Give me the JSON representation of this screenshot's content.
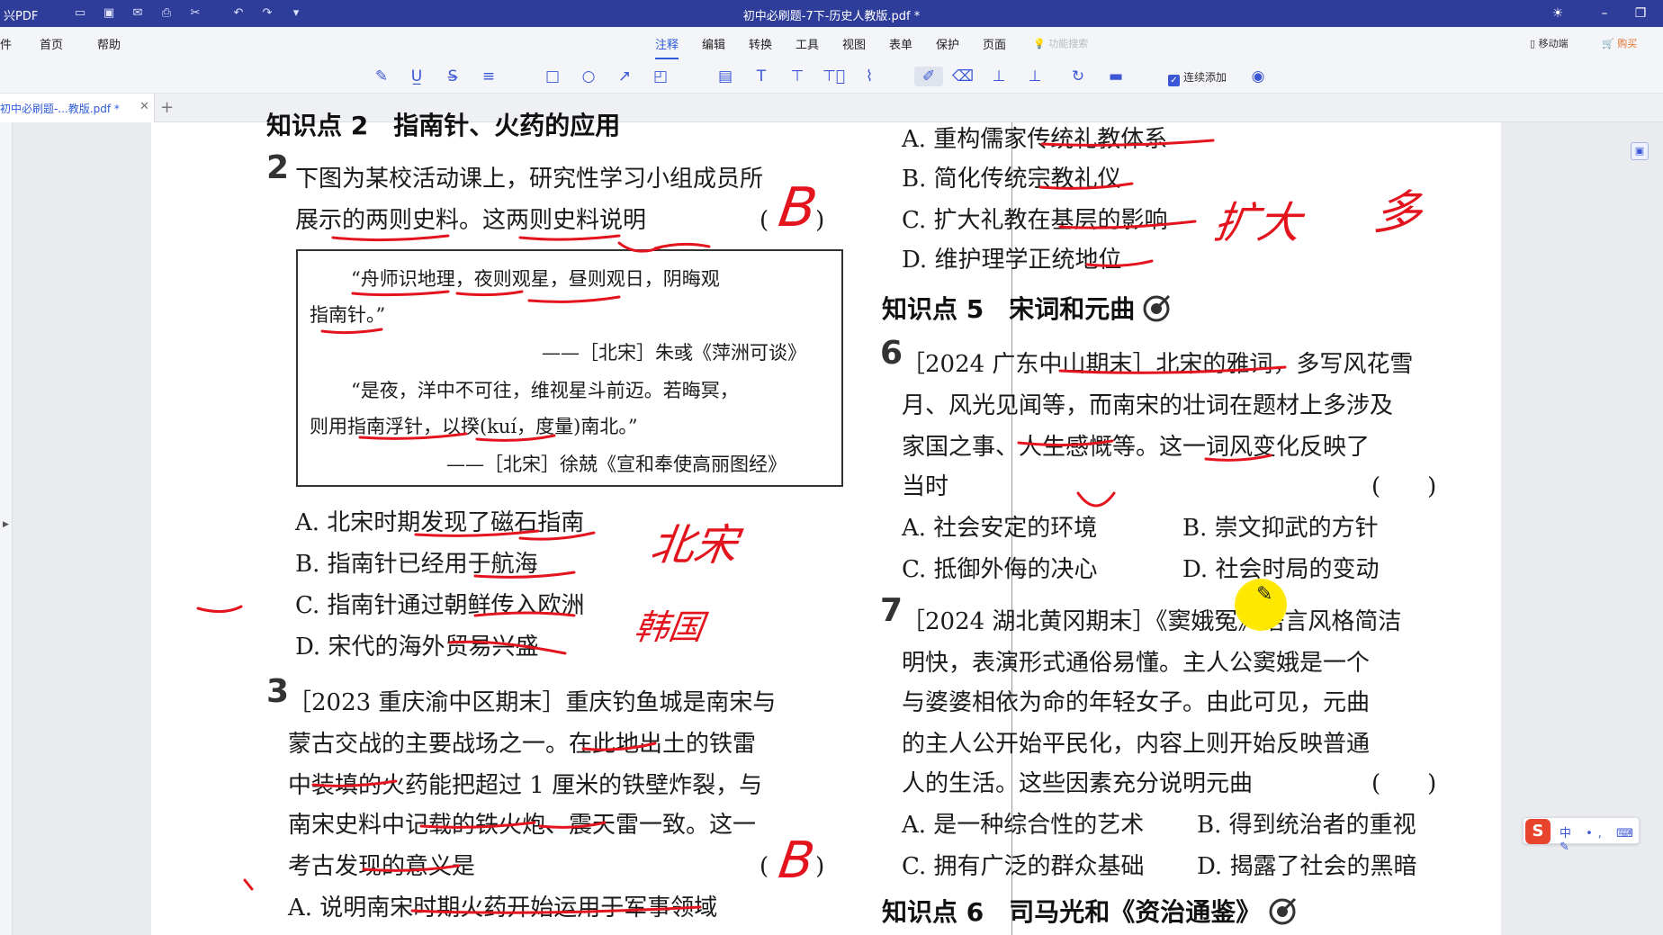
{
  "titlebar": {
    "app_name": "兴PDF",
    "doc_title": "初中必刷题-7下-历史人教版.pdf *"
  },
  "menubar": {
    "left_items": [
      "件",
      "首页",
      "帮助"
    ],
    "tabs": [
      "注释",
      "编辑",
      "转换",
      "工具",
      "视图",
      "表单",
      "保护",
      "页面"
    ],
    "active_tab": "注释",
    "feature_search": "功能搜索",
    "mobile": "移动端",
    "buy": "购买"
  },
  "toolbar": {
    "continuous_add": "连续添加"
  },
  "doc_tab": {
    "label": "初中必刷题-...教版.pdf *"
  },
  "content": {
    "left_top_heading": "知识点 2　指南针、火药的应用",
    "q2": {
      "num": "2",
      "lines": [
        "下图为某校活动课上，研究性学习小组成员所",
        "展示的两则史料。这两则史料说明"
      ],
      "paren": "(　　)",
      "quote1": [
        "“舟师识地理，夜则观星，昼则观日，阴晦观",
        "指南针。”"
      ],
      "source1": "——［北宋］朱彧《萍洲可谈》",
      "quote2": [
        "“是夜，洋中不可往，维视星斗前迈。若晦冥，",
        "则用指南浮针，以揆(kuí，度量)南北。”"
      ],
      "source2": "——［北宋］徐兢《宣和奉使高丽图经》",
      "options": [
        "A. 北宋时期发现了磁石指南",
        "B. 指南针已经用于航海",
        "C. 指南针通过朝鲜传入欧洲",
        "D. 宋代的海外贸易兴盛"
      ]
    },
    "q3": {
      "num": "3",
      "lines": [
        "［2023 重庆渝中区期末］重庆钓鱼城是南宋与",
        "蒙古交战的主要战场之一。在此地出土的铁雷",
        "中装填的火药能把超过 1 厘米的铁壁炸裂，与",
        "南宋史料中记载的铁火炮、震天雷一致。这一",
        "考古发现的意义是"
      ],
      "paren": "(　　)",
      "option_a": "A. 说明南宋时期火药开始运用于军事领域"
    },
    "right_top_options": [
      "A. 重构儒家传统礼教体系",
      "B. 简化传统宗教礼仪",
      "C. 扩大礼教在基层的影响",
      "D. 维护理学正统地位"
    ],
    "heading5": "知识点 5　宋词和元曲",
    "q6": {
      "num": "6",
      "lines": [
        "［2024 广东中山期末］北宋的雅词，多写风花雪",
        "月、风光见闻等，而南宋的壮词在题材上多涉及",
        "家国之事、人生感慨等。这一词风变化反映了",
        "当时"
      ],
      "paren": "(　　)",
      "options": [
        "A. 社会安定的环境",
        "B. 崇文抑武的方针",
        "C. 抵御外侮的决心",
        "D. 社会时局的变动"
      ]
    },
    "q7": {
      "num": "7",
      "lines": [
        "［2024 湖北黄冈期末］《窦娥冤》语言风格简洁",
        "明快，表演形式通俗易懂。主人公窦娥是一个",
        "与婆婆相依为命的年轻女子。由此可见，元曲",
        "的主人公开始平民化，内容上则开始反映普通",
        "人的生活。这些因素充分说明元曲"
      ],
      "paren": "(　　)",
      "options": [
        "A. 是一种综合性的艺术",
        "B. 得到统治者的重视",
        "C. 拥有广泛的群众基础",
        "D. 揭露了社会的黑暗"
      ]
    },
    "heading6": "知识点 6　司马光和《资治通鉴》"
  },
  "handwriting": {
    "q2_answer": "B",
    "q3_answer": "B",
    "note_north_song": "北宋",
    "note_korea": "韩国",
    "note_expand": "扩大",
    "note_more": "多"
  },
  "ime": {
    "brand": "S",
    "status": "中 •, ⌨ ✎"
  },
  "colors": {
    "title_bar": "#2f3d9a",
    "accent": "#2f5bd8",
    "ink_red": "#e3141d"
  }
}
